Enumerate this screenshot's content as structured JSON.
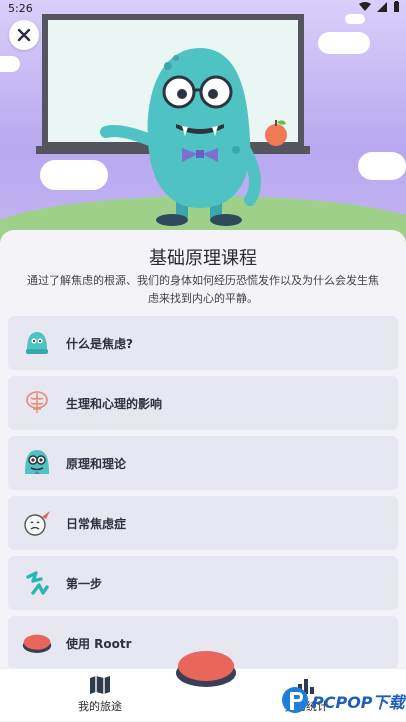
{
  "status_bar": {
    "time": "5:26"
  },
  "course": {
    "title": "基础原理课程",
    "description": "通过了解焦虑的根源、我们的身体如何经历恐慌发作以及为什么会发生焦虑来找到内心的平静。"
  },
  "lessons": [
    {
      "label": "什么是焦虑?",
      "icon": "small-monster-icon"
    },
    {
      "label": "生理和心理的影响",
      "icon": "brain-icon"
    },
    {
      "label": "原理和理论",
      "icon": "monster-face-icon"
    },
    {
      "label": "日常焦虑症",
      "icon": "worried-face-icon"
    },
    {
      "label": "第一步",
      "icon": "steps-icon"
    },
    {
      "label": "使用 Rootr",
      "icon": "red-button-icon"
    }
  ],
  "bottom_nav": {
    "journey_label": "我的旅途",
    "stats_label": "我的统计"
  },
  "watermark": {
    "text": "PCPOP下载"
  },
  "colors": {
    "accent_red": "#e9665a",
    "monster_teal": "#4fc3c4",
    "panel": "#f4f4f8",
    "lesson_bg": "#e6e7f1"
  }
}
